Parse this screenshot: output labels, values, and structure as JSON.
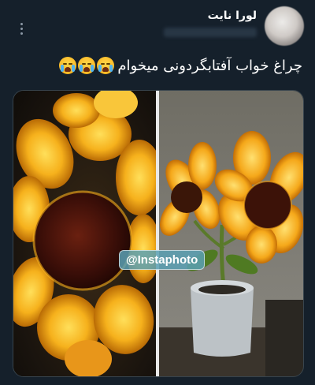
{
  "author": {
    "display_name": "لورا نایت"
  },
  "tweet": {
    "text": "چراغ خواب آفتابگردونی میخوام",
    "emojis": [
      "loudly-crying-face",
      "loudly-crying-face",
      "loudly-crying-face"
    ]
  },
  "media": {
    "watermark": "@Instaphoto"
  },
  "colors": {
    "background": "#15202b",
    "petal": "#f6b11c",
    "watermark_bg": "#5aa0b4"
  }
}
